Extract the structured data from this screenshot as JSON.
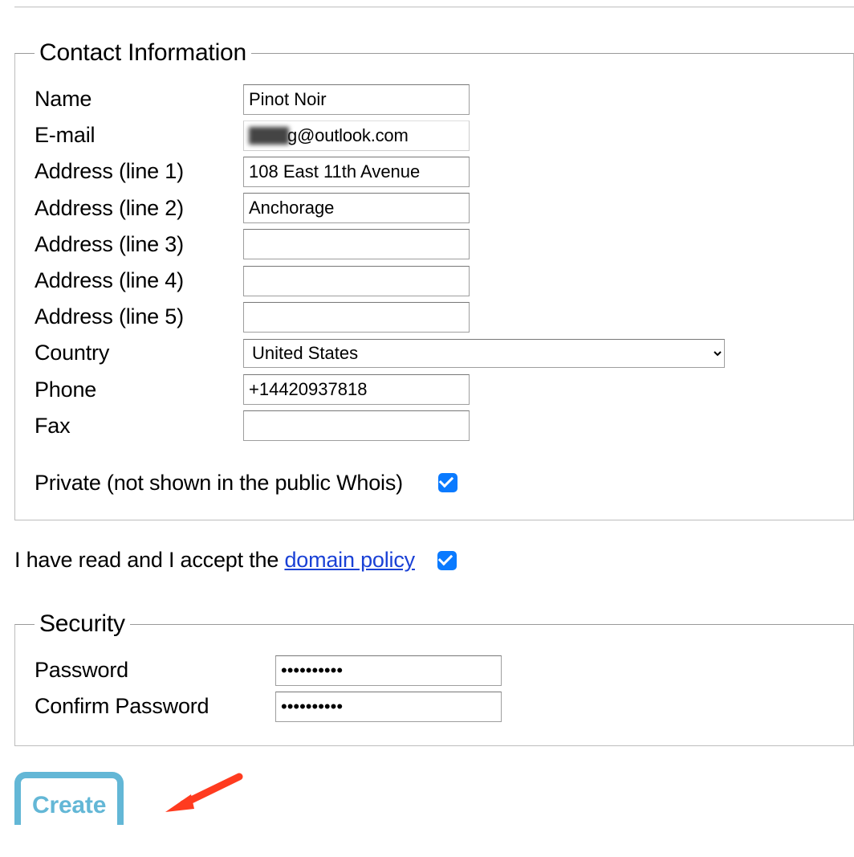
{
  "contact": {
    "legend": "Contact Information",
    "fields": {
      "name": {
        "label": "Name",
        "value": "Pinot Noir"
      },
      "email": {
        "label": "E-mail",
        "value": "g@outlook.com",
        "masked": true
      },
      "addr1": {
        "label": "Address (line 1)",
        "value": "108 East 11th Avenue"
      },
      "addr2": {
        "label": "Address (line 2)",
        "value": "Anchorage"
      },
      "addr3": {
        "label": "Address (line 3)",
        "value": ""
      },
      "addr4": {
        "label": "Address (line 4)",
        "value": ""
      },
      "addr5": {
        "label": "Address (line 5)",
        "value": ""
      },
      "country": {
        "label": "Country",
        "value": "United States"
      },
      "phone": {
        "label": "Phone",
        "value": "+14420937818"
      },
      "fax": {
        "label": "Fax",
        "value": ""
      }
    },
    "private": {
      "label": "Private (not shown in the public Whois)",
      "checked": true
    }
  },
  "policy": {
    "prefix": "I have read and I accept the ",
    "link_text": "domain policy",
    "checked": true
  },
  "security": {
    "legend": "Security",
    "password": {
      "label": "Password",
      "value": "••••••••••"
    },
    "confirm_password": {
      "label": "Confirm Password",
      "value": "••••••••••"
    }
  },
  "actions": {
    "create": "Create"
  }
}
